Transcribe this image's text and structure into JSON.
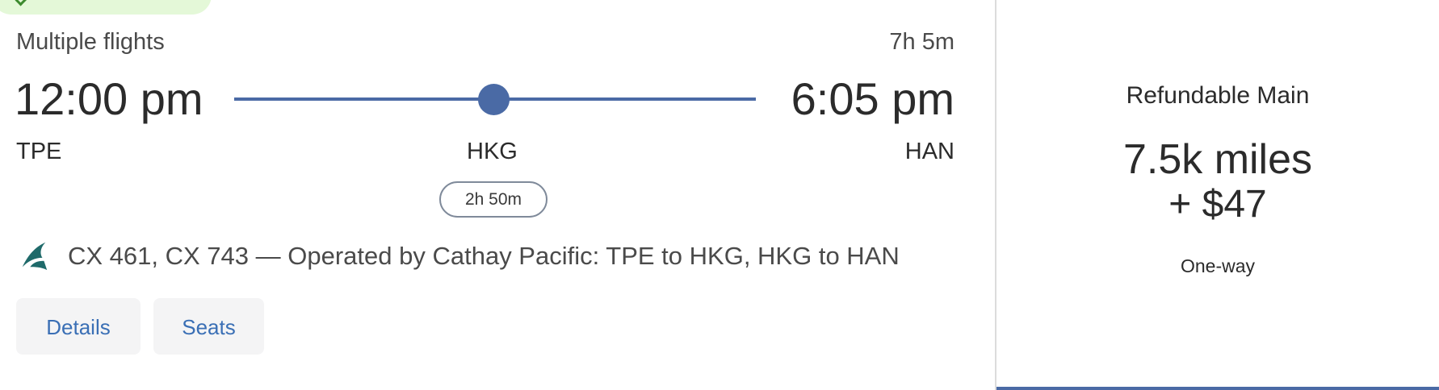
{
  "flight": {
    "summary_label": "Multiple flights",
    "total_duration": "7h 5m",
    "depart_time": "12:00 pm",
    "arrive_time": "6:05 pm",
    "origin": "TPE",
    "stop": "HKG",
    "destination": "HAN",
    "layover_duration": "2h 50m",
    "carrier_details": "CX 461, CX 743 — Operated by Cathay Pacific: TPE to HKG, HKG to HAN",
    "carrier_icon": "cathay-pacific-logo-icon"
  },
  "actions": {
    "details_label": "Details",
    "seats_label": "Seats"
  },
  "fare": {
    "name": "Refundable Main",
    "miles": "7.5k miles",
    "cash": "+ $47",
    "trip_type": "One-way"
  },
  "colors": {
    "route": "#4a6aa5",
    "link": "#3a6fb5",
    "badge_bg": "#e4f8d8"
  }
}
